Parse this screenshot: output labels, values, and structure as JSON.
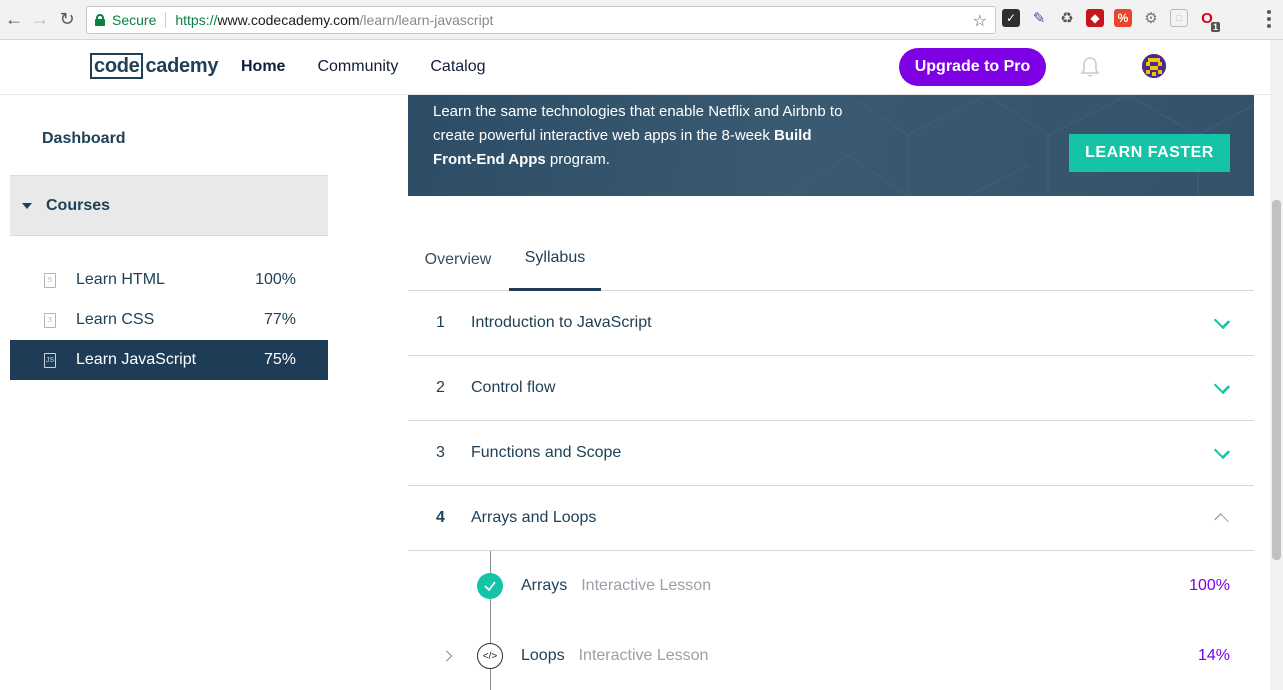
{
  "browser": {
    "secure_label": "Secure",
    "url_scheme": "https://",
    "url_host": "www.codecademy.com",
    "url_path": "/learn/learn-javascript",
    "extension_badge": "1"
  },
  "header": {
    "logo_boxed": "code",
    "logo_rest": "cademy",
    "nav": [
      "Home",
      "Community",
      "Catalog"
    ],
    "active_nav": "Home",
    "upgrade_label": "Upgrade to Pro"
  },
  "sidebar": {
    "dashboard_label": "Dashboard",
    "courses_label": "Courses",
    "courses": [
      {
        "name": "Learn HTML",
        "progress": "100%",
        "icon_text": "",
        "active": false
      },
      {
        "name": "Learn CSS",
        "progress": "77%",
        "icon_text": "",
        "active": false
      },
      {
        "name": "Learn JavaScript",
        "progress": "75%",
        "icon_text": "JS",
        "active": true
      }
    ]
  },
  "banner": {
    "text_before": "Learn the same technologies that enable Netflix and Airbnb to create powerful interactive web apps in the 8-week ",
    "text_bold": "Build Front-End Apps",
    "text_after": " program.",
    "cta_label": "LEARN FASTER"
  },
  "tabs": {
    "overview": "Overview",
    "syllabus": "Syllabus",
    "active": "Syllabus"
  },
  "syllabus": {
    "units": [
      {
        "number": "1",
        "title": "Introduction to JavaScript",
        "expanded": false
      },
      {
        "number": "2",
        "title": "Control flow",
        "expanded": false
      },
      {
        "number": "3",
        "title": "Functions and Scope",
        "expanded": false
      },
      {
        "number": "4",
        "title": "Arrays and Loops",
        "expanded": true
      }
    ],
    "lessons": [
      {
        "title": "Arrays",
        "type": "Interactive Lesson",
        "progress": "100%",
        "status": "complete"
      },
      {
        "title": "Loops",
        "type": "Interactive Lesson",
        "progress": "14%",
        "status": "in-progress"
      }
    ]
  },
  "colors": {
    "brand_navy": "#1f4056",
    "pro_purple": "#7e00e5",
    "teal": "#15c3a6"
  }
}
